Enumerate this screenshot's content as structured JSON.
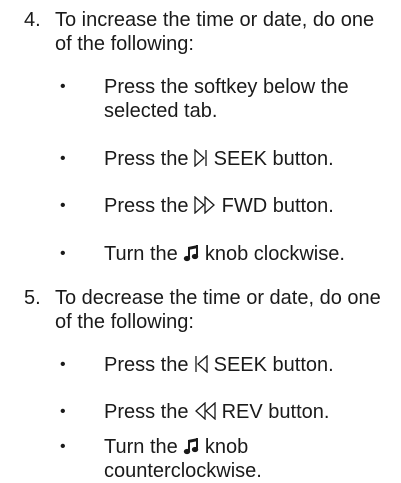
{
  "steps": [
    {
      "number": "4.",
      "text": "To increase the time or date, do one of the following:",
      "bullets": [
        {
          "marker": "•",
          "pre": "Press the softkey below the selected tab.",
          "icon": "",
          "post": ""
        },
        {
          "marker": "•",
          "pre": "Press the ",
          "icon": "seek-forward-icon",
          "post": " SEEK button."
        },
        {
          "marker": "•",
          "pre": "Press the ",
          "icon": "fast-forward-icon",
          "post": " FWD button."
        },
        {
          "marker": "•",
          "pre": "Turn the ",
          "icon": "music-note-icon",
          "post": " knob clockwise."
        }
      ]
    },
    {
      "number": "5.",
      "text": "To decrease the time or date, do one of the following:",
      "bullets": [
        {
          "marker": "•",
          "pre": "Press the ",
          "icon": "seek-back-icon",
          "post": " SEEK button."
        },
        {
          "marker": "•",
          "pre": "Press the ",
          "icon": "rewind-icon",
          "post": " REV button."
        },
        {
          "marker": "•",
          "pre": "Turn the ",
          "icon": "music-note-icon",
          "post": " knob counterclockwise."
        }
      ]
    }
  ],
  "colors": {
    "text": "#1a1a1a",
    "background": "#ffffff"
  }
}
